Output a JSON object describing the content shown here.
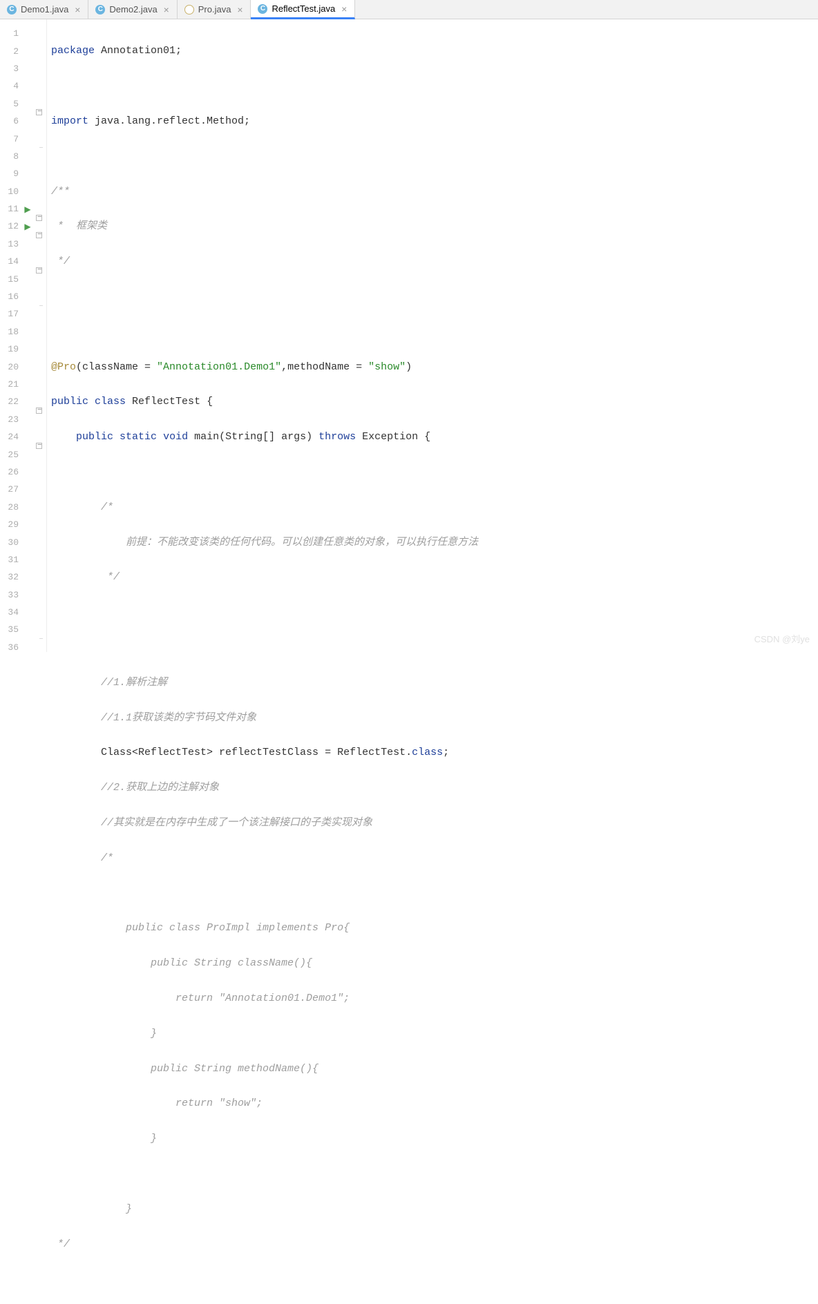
{
  "tabs": [
    {
      "icon": "C",
      "iconClass": "icon-c",
      "label": "Demo1.java"
    },
    {
      "icon": "C",
      "iconClass": "icon-c",
      "label": "Demo2.java"
    },
    {
      "icon": "@",
      "iconClass": "icon-at",
      "label": "Pro.java"
    },
    {
      "icon": "C",
      "iconClass": "icon-c",
      "label": "ReflectTest.java"
    }
  ],
  "lines": {
    "count": 36
  },
  "code": {
    "l1_kw": "package",
    "l1_rest": " Annotation01;",
    "l3_kw": "import",
    "l3_rest": " java.lang.reflect.Method;",
    "l5": "/**",
    "l6": " *  框架类",
    "l7": " */",
    "l10_ann": "@Pro",
    "l10_a": "(className = ",
    "l10_s1": "\"Annotation01.Demo1\"",
    "l10_b": ",methodName = ",
    "l10_s2": "\"show\"",
    "l10_c": ")",
    "l11_kw1": "public",
    "l11_kw2": "class",
    "l11_rest": " ReflectTest {",
    "l12_kw1": "public",
    "l12_kw2": "static",
    "l12_kw3": "void",
    "l12_m": " main",
    "l12_p": "(String[] args) ",
    "l12_kw4": "throws",
    "l12_rest": " Exception {",
    "l14": "        /*",
    "l15": "            前提：不能改变该类的任何代码。可以创建任意类的对象，可以执行任意方法",
    "l16": "         */",
    "l19": "        //1.解析注解",
    "l20": "        //1.1获取该类的字节码文件对象",
    "l21_a": "        Class<ReflectTest> reflectTestClass = ReflectTest.",
    "l21_kw": "class",
    "l21_b": ";",
    "l22": "        //2.获取上边的注解对象",
    "l23": "        //其实就是在内存中生成了一个该注解接口的子类实现对象",
    "l24": "        /*",
    "l26": "            public class ProImpl implements Pro{",
    "l27": "                public String className(){",
    "l28": "                    return \"Annotation01.Demo1\";",
    "l29": "                }",
    "l30": "                public String methodName(){",
    "l31": "                    return \"show\";",
    "l32": "                }",
    "l34": "            }",
    "l35": " */"
  },
  "watermark": "CSDN @刘ye"
}
